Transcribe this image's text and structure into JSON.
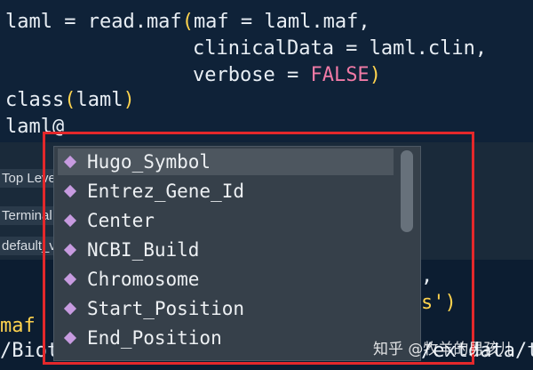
{
  "code": {
    "line1": {
      "prefix": "laml = read.maf",
      "open": "(",
      "rest": "maf = laml.maf,"
    },
    "line2": "clinicalData = laml.clin,",
    "line3": {
      "prefix": "verbose = ",
      "value": "FALSE",
      "close": ")"
    },
    "line4": {
      "fn": "class",
      "open": "(",
      "arg": "laml",
      "close": ")"
    },
    "line5": "laml@"
  },
  "background": {
    "tab_top_level": "Top Leve",
    "tab_terminal": "Terminal",
    "tab_default": "default_v",
    "console_right1": ",",
    "console_right2": "s')",
    "console_left1": "maf",
    "console_left2": "/Bioto",
    "console_right3": "/extdata/t"
  },
  "autocomplete": {
    "items": [
      {
        "label": "Hugo_Symbol"
      },
      {
        "label": "Entrez_Gene_Id"
      },
      {
        "label": "Center"
      },
      {
        "label": "NCBI_Build"
      },
      {
        "label": "Chromosome"
      },
      {
        "label": "Start_Position"
      },
      {
        "label": "End_Position"
      }
    ]
  },
  "watermark": "知乎 @牧羊的男孩儿",
  "colors": {
    "highlight": "#e4282b",
    "diamond": "#c79be0",
    "keyword_false": "#f07aa6"
  }
}
